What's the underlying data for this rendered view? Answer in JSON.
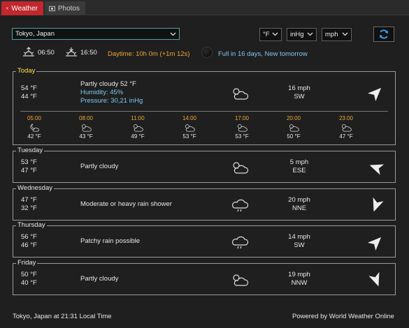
{
  "tabs": [
    {
      "label": "Weather",
      "icon": "umbrella-icon",
      "active": true
    },
    {
      "label": "Photos",
      "icon": "photo-icon",
      "active": false
    }
  ],
  "controls": {
    "location": "Tokyo, Japan",
    "temp_unit": "°F",
    "pressure_unit": "inHg",
    "wind_unit": "mph"
  },
  "sun": {
    "sunrise": "06:50",
    "sunset": "16:50",
    "daytime": "Daytime: 10h 0m (+1m 12s)",
    "moon": "Full in 16 days, New tomorrow"
  },
  "today": {
    "label": "Today",
    "high": "54 °F",
    "low": "44 °F",
    "condition": "Partly cloudy 52 °F",
    "humidity": "Humidity: 45%",
    "pressure": "Pressure: 30,21 inHg",
    "icon": "partly-cloudy-icon",
    "wind_speed": "16 mph",
    "wind_dir": "SW",
    "hourly": [
      {
        "time": "05:00",
        "temp": "42 °F",
        "icon": "moon-cloud-icon"
      },
      {
        "time": "08:00",
        "temp": "43 °F",
        "icon": "partly-cloudy-icon"
      },
      {
        "time": "11:00",
        "temp": "49 °F",
        "icon": "partly-cloudy-icon"
      },
      {
        "time": "14:00",
        "temp": "53 °F",
        "icon": "partly-cloudy-icon"
      },
      {
        "time": "17:00",
        "temp": "53 °F",
        "icon": "partly-cloudy-icon"
      },
      {
        "time": "20:00",
        "temp": "50 °F",
        "icon": "partly-cloudy-icon"
      },
      {
        "time": "23:00",
        "temp": "47 °F",
        "icon": "partly-cloudy-icon"
      }
    ]
  },
  "days": [
    {
      "label": "Tuesday",
      "high": "53 °F",
      "low": "47 °F",
      "condition": "Partly cloudy",
      "icon": "partly-cloudy-icon",
      "wind_speed": "5 mph",
      "wind_dir": "ESE"
    },
    {
      "label": "Wednesday",
      "high": "47 °F",
      "low": "32 °F",
      "condition": "Moderate or heavy rain shower",
      "icon": "rain-cloud-icon",
      "wind_speed": "20 mph",
      "wind_dir": "NNE"
    },
    {
      "label": "Thursday",
      "high": "56 °F",
      "low": "46 °F",
      "condition": "Patchy rain possible",
      "icon": "rain-cloud-icon",
      "wind_speed": "14 mph",
      "wind_dir": "SW"
    },
    {
      "label": "Friday",
      "high": "50 °F",
      "low": "40 °F",
      "condition": "Partly cloudy",
      "icon": "partly-cloudy-icon",
      "wind_speed": "19 mph",
      "wind_dir": "NNW"
    }
  ],
  "footer": {
    "location_time": "Tokyo, Japan at 21:31 Local Time",
    "powered": "Powered by World Weather Online"
  }
}
